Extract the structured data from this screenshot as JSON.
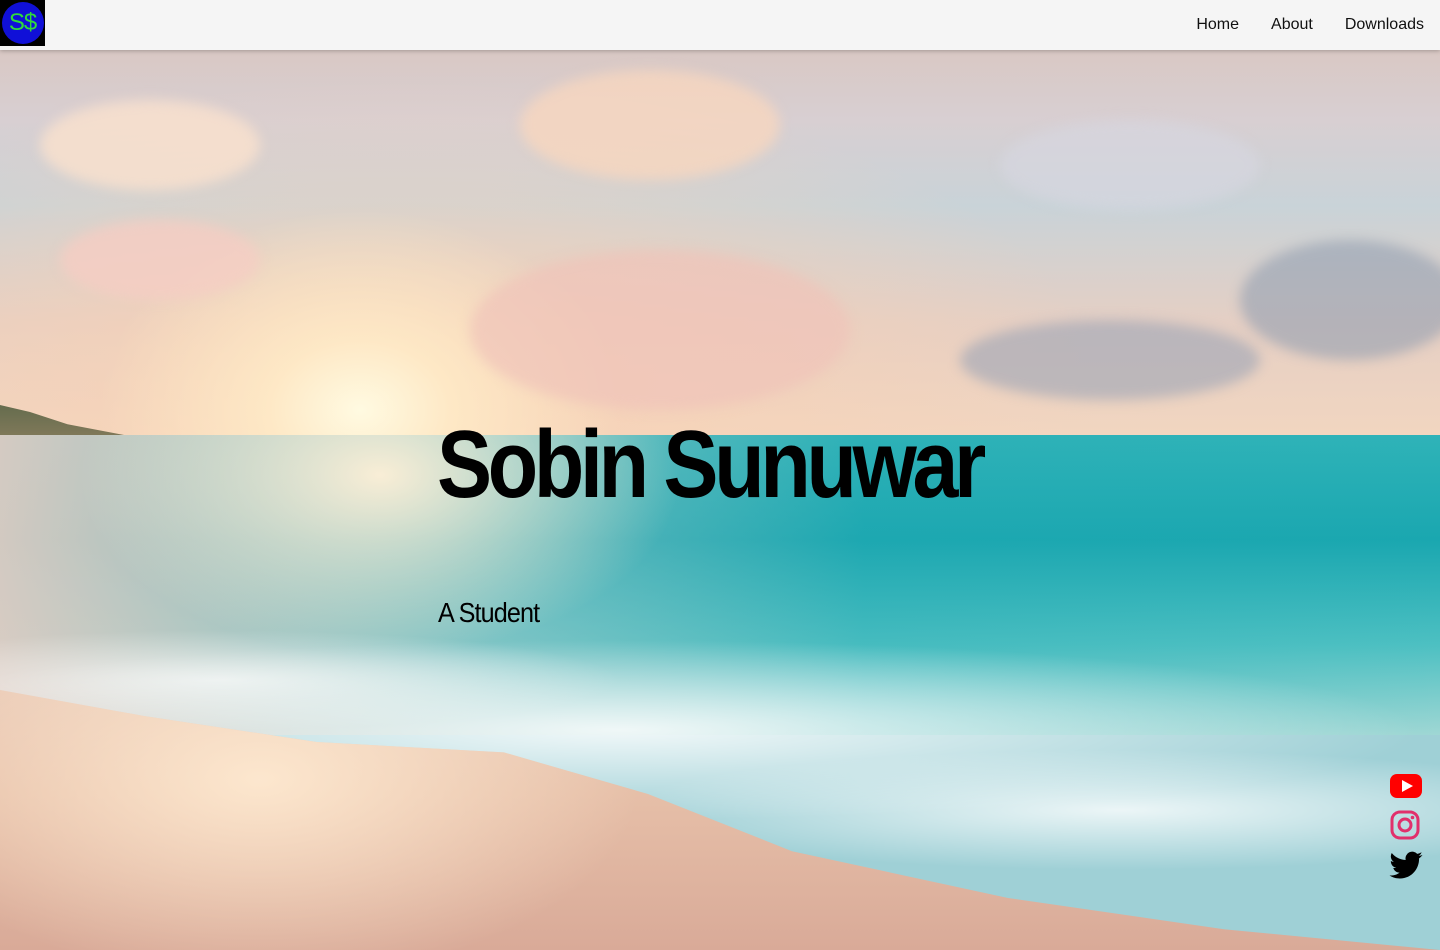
{
  "header": {
    "logo_text": "S$",
    "nav": [
      {
        "label": "Home"
      },
      {
        "label": "About"
      },
      {
        "label": "Downloads"
      }
    ]
  },
  "hero": {
    "name": "Sobin Sunuwar",
    "subtitle": "A Student"
  },
  "social": [
    {
      "icon": "youtube-icon",
      "color": "#ff0000"
    },
    {
      "icon": "instagram-icon",
      "color": "#e1306c"
    },
    {
      "icon": "twitter-icon",
      "color": "#000000"
    }
  ],
  "colors": {
    "logo_background": "#1010d8",
    "logo_text": "#2fdc3a",
    "header_background": "#f5f5f5"
  }
}
